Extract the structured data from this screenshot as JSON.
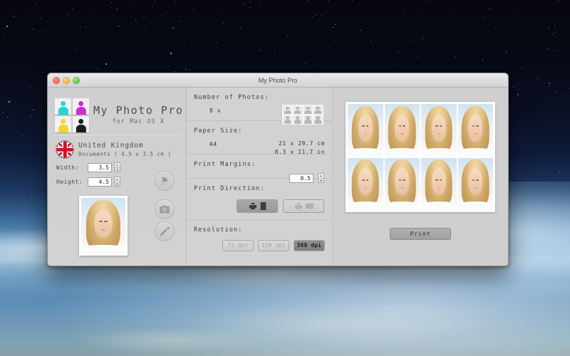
{
  "window": {
    "title": "My Photo Pro",
    "traffic_lights": [
      "close-button",
      "minimize-button",
      "maximize-button"
    ]
  },
  "brand": {
    "app_title": "My Photo Pro",
    "subtitle": "for Mac OS X",
    "logo_colors": [
      "#2ad4d4",
      "#cc2ecc",
      "#ecd92b",
      "#1c1c1c"
    ]
  },
  "country": {
    "name": "United Kingdom",
    "description": "Documents ( 4.5 x 3.5 cm )",
    "flag_icon": "uk-flag-icon"
  },
  "dimensions": {
    "width_label": "Width:",
    "width_value": "3.5",
    "height_label": "Height:",
    "height_value": "4.5"
  },
  "side_buttons": [
    {
      "name": "flag-button",
      "icon": "flag-icon"
    },
    {
      "name": "camera-button",
      "icon": "camera-icon"
    },
    {
      "name": "edit-button",
      "icon": "pen-icon"
    }
  ],
  "sections": {
    "number_of_photos": {
      "heading": "Number of Photos:",
      "value": "8 x",
      "thumbnail_count": 8
    },
    "paper_size": {
      "heading": "Paper Size:",
      "value": "A4",
      "metric": "21 x 29.7 cm",
      "imperial": "8.3 x 11.7 in"
    },
    "print_margins": {
      "heading": "Print Margins:",
      "value": "0.5"
    },
    "print_direction": {
      "heading": "Print Direction:",
      "options": [
        {
          "label": "portrait",
          "selected": true
        },
        {
          "label": "landscape",
          "selected": false
        }
      ]
    },
    "resolution": {
      "heading": "Resolution:",
      "options": [
        {
          "label": "72 dpi",
          "selected": false
        },
        {
          "label": "150 dpi",
          "selected": false
        },
        {
          "label": "300 dpi",
          "selected": true
        }
      ]
    }
  },
  "preview": {
    "photo_count": 8,
    "columns": 4,
    "rows": 2
  },
  "actions": {
    "print_label": "Print"
  },
  "colors": {
    "window_bg": "#d2d2d2",
    "panel_bg": "#cfcfcf",
    "text": "#3f3f3f",
    "selected_button": "#8f8f8f",
    "sheet_white": "#ffffff"
  }
}
